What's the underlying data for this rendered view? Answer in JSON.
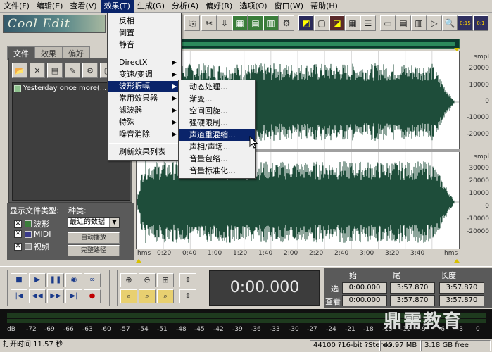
{
  "menubar": [
    {
      "label": "文件(F)"
    },
    {
      "label": "编辑(E)"
    },
    {
      "label": "查看(V)"
    },
    {
      "label": "效果(T)"
    },
    {
      "label": "生成(G)"
    },
    {
      "label": "分析(A)"
    },
    {
      "label": "偏好(R)"
    },
    {
      "label": "选项(O)"
    },
    {
      "label": "窗口(W)"
    },
    {
      "label": "帮助(H)"
    }
  ],
  "logo": {
    "text": "Cool Edit"
  },
  "left_panel": {
    "tabs": [
      "文件",
      "效果",
      "偏好"
    ],
    "file_item": "Yesterday once more(...",
    "file_type_label": "显示文件类型:",
    "kind_label": "种类:",
    "file_types": [
      {
        "checked": "✕",
        "label": "波形"
      },
      {
        "checked": "✕",
        "label": "MIDI"
      },
      {
        "checked": "✕",
        "label": "视频"
      }
    ],
    "kind_select": "最近的数据",
    "btn_auto": "自动播放",
    "btn_fullpath": "完整路径"
  },
  "effects_menu": {
    "items": [
      {
        "label": "反相",
        "sub": false
      },
      {
        "label": "倒置",
        "sub": false
      },
      {
        "label": "静音",
        "sub": false
      },
      {
        "label": "DirectX",
        "sub": true
      },
      {
        "label": "变速/变调",
        "sub": true
      },
      {
        "label": "波形振幅",
        "sub": true
      },
      {
        "label": "常用效果器",
        "sub": true
      },
      {
        "label": "滤波器",
        "sub": true
      },
      {
        "label": "特殊",
        "sub": true
      },
      {
        "label": "噪音消除",
        "sub": true
      },
      {
        "label": "刷新效果列表",
        "sub": false
      }
    ],
    "highlighted": "波形振幅"
  },
  "amplitude_submenu": {
    "items": [
      "动态处理...",
      "渐变...",
      "空间回旋...",
      "强硬限制...",
      "声道重混缩...",
      "声相/声场...",
      "音量包络...",
      "音量标准化..."
    ],
    "highlighted": "声道重混缩..."
  },
  "vertical_ruler": {
    "top_labels": [
      "smpl",
      "20000",
      "10000",
      "0",
      "-10000",
      "-20000"
    ],
    "bottom_labels": [
      "smpl",
      "30000",
      "20000",
      "10000",
      "0",
      "-10000",
      "-20000"
    ]
  },
  "time_ruler": [
    "hms",
    "0:20",
    "0:40",
    "1:00",
    "1:20",
    "1:40",
    "2:00",
    "2:20",
    "2:40",
    "3:00",
    "3:20",
    "3:40",
    "hms"
  ],
  "time_display": "0:00.000",
  "selection_info": {
    "headers": [
      "始",
      "尾",
      "长度"
    ],
    "rows": [
      {
        "label": "选",
        "values": [
          "0:00.000",
          "3:57.870",
          "3:57.870"
        ]
      },
      {
        "label": "查看",
        "values": [
          "0:00.000",
          "3:57.870",
          "3:57.870"
        ]
      }
    ]
  },
  "level_scale": [
    "dB",
    "-72",
    "-69",
    "-66",
    "-63",
    "-60",
    "-57",
    "-54",
    "-51",
    "-48",
    "-45",
    "-42",
    "-39",
    "-36",
    "-33",
    "-30",
    "-27",
    "-24",
    "-21",
    "-18",
    "-15",
    "-12",
    "-9",
    "-6",
    "-3",
    "0"
  ],
  "watermark": "鼎需教育",
  "status": {
    "open_time": "打开时间  11.57 秒",
    "format": "44100 ?16-bit ?Stereo",
    "size": "40.97 MB",
    "free": "3.18 GB free"
  },
  "colors": {
    "waveform": "#1e4d3a",
    "highlight": "#0a246a",
    "panel_dark": "#5a5a5a"
  }
}
